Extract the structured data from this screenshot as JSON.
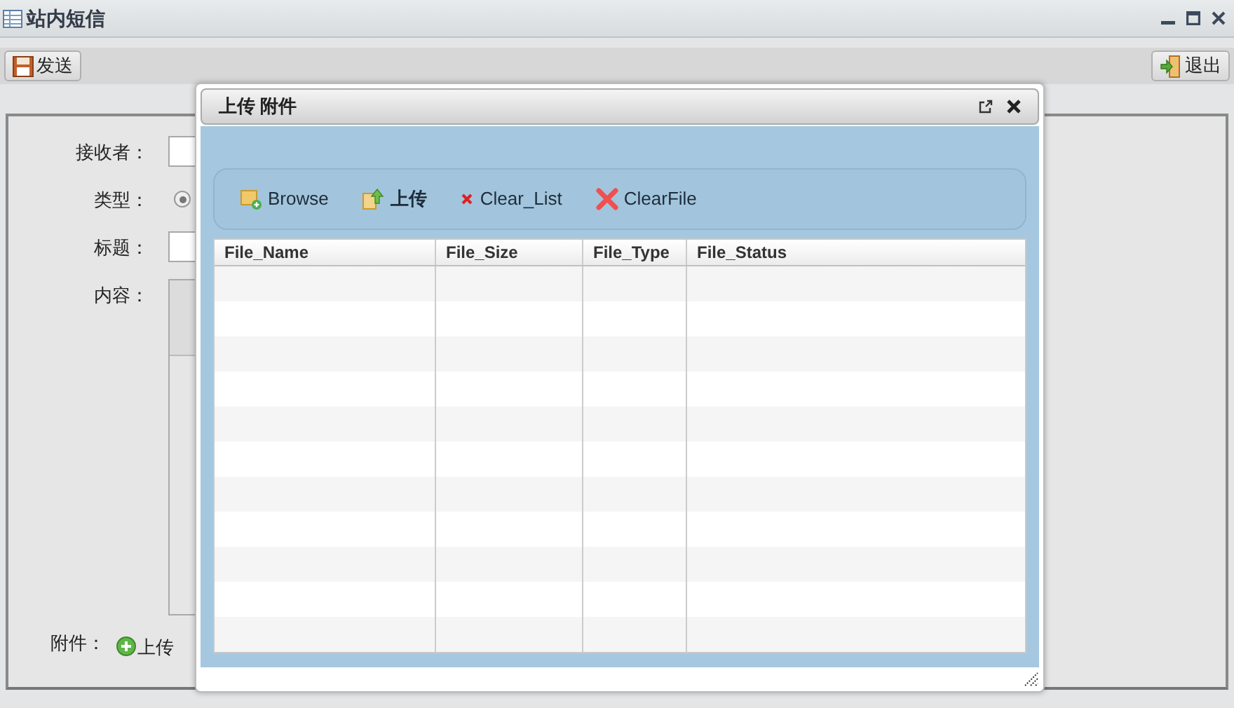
{
  "window": {
    "title": "站内短信"
  },
  "toolbar": {
    "buttons": [
      {
        "label": "发送",
        "kind": "save"
      },
      {
        "label": "退出",
        "kind": "exit"
      }
    ]
  },
  "form": {
    "fields": [
      {
        "label": "接收者：",
        "kind": "text"
      },
      {
        "label": "类型：",
        "kind": "radio",
        "checked": true
      },
      {
        "label": "标题：",
        "kind": "text"
      },
      {
        "label": "内容：",
        "kind": "editor"
      }
    ],
    "attachment": {
      "label": "附件：",
      "button": "上传"
    }
  },
  "dialog": {
    "title": "上传 附件",
    "toolbar": [
      {
        "label": "Browse",
        "kind": "browse"
      },
      {
        "label": "上传",
        "kind": "upload"
      },
      {
        "label": "Clear_List",
        "kind": "clear"
      },
      {
        "label": "ClearFile",
        "kind": "delete"
      }
    ],
    "table": {
      "columns": [
        "File_Name",
        "File_Size",
        "File_Type",
        "File_Status"
      ]
    }
  }
}
